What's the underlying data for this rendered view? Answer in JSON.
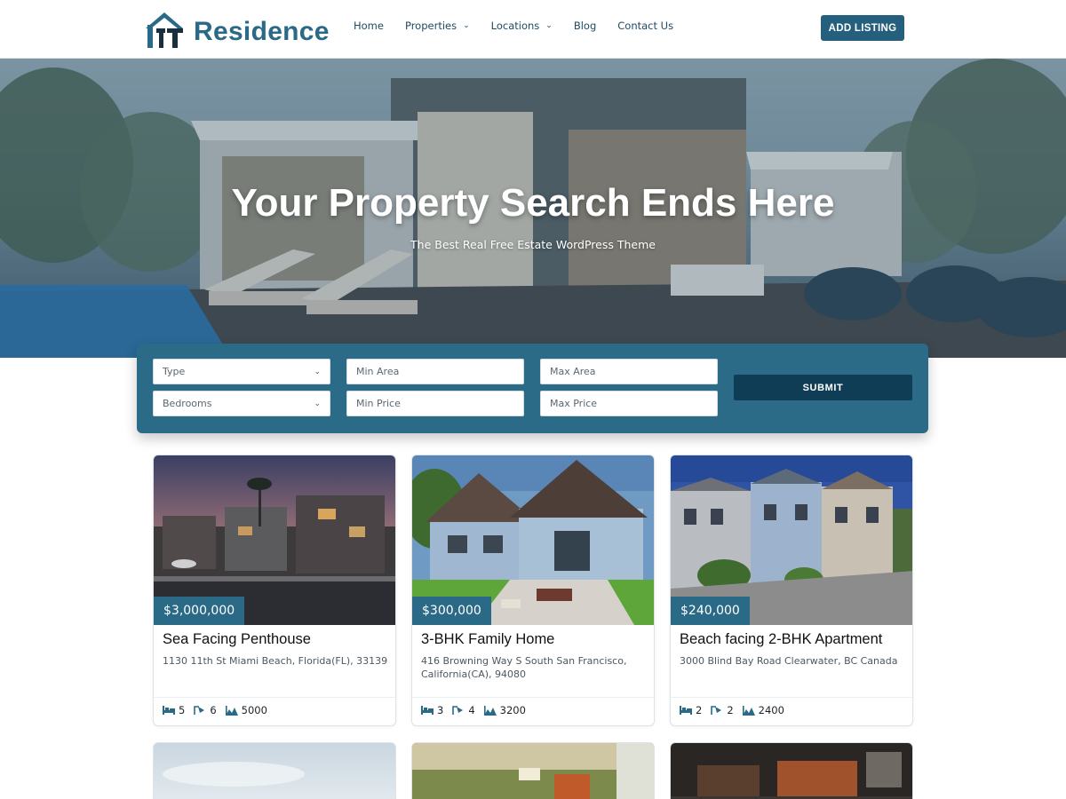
{
  "brand": {
    "name": "Residence",
    "accent": "#2a6a86",
    "dark": "#0f3d56"
  },
  "nav": {
    "items": [
      {
        "label": "Home",
        "dropdown": false
      },
      {
        "label": "Properties",
        "dropdown": true
      },
      {
        "label": "Locations",
        "dropdown": true
      },
      {
        "label": "Blog",
        "dropdown": false
      },
      {
        "label": "Contact Us",
        "dropdown": false
      }
    ],
    "cta": "ADD LISTING"
  },
  "hero": {
    "title": "Your Property Search Ends Here",
    "subtitle": "The Best Real Free Estate WordPress Theme"
  },
  "search": {
    "type": "Type",
    "bedrooms": "Bedrooms",
    "min_area": "Min Area",
    "max_area": "Max Area",
    "min_price": "Min Price",
    "max_price": "Max Price",
    "submit": "SUBMIT"
  },
  "listings": [
    {
      "price": "$3,000,000",
      "title": "Sea Facing Penthouse",
      "address": "1130 11th St Miami Beach, Florida(FL), 33139",
      "beds": "5",
      "baths": "6",
      "area": "5000"
    },
    {
      "price": "$300,000",
      "title": "3-BHK Family Home",
      "address": "416 Browning Way S South San Francisco, California(CA), 94080",
      "beds": "3",
      "baths": "4",
      "area": "3200"
    },
    {
      "price": "$240,000",
      "title": "Beach facing 2-BHK Apartment",
      "address": "3000 Blind Bay Road Clearwater, BC Canada",
      "beds": "2",
      "baths": "2",
      "area": "2400"
    }
  ]
}
